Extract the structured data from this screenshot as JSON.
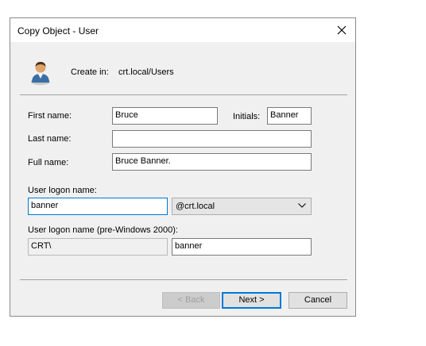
{
  "window": {
    "title": "Copy Object - User"
  },
  "header": {
    "create_in_label": "Create in:",
    "create_in_value": "crt.local/Users",
    "icon": "user-icon"
  },
  "form": {
    "first_name_label": "First name:",
    "first_name_value": "Bruce",
    "initials_label": "Initials:",
    "initials_value": "Banner",
    "last_name_label": "Last name:",
    "last_name_value": "",
    "full_name_label": "Full name:",
    "full_name_value": "Bruce Banner.",
    "logon_label": "User logon name:",
    "logon_value": "banner",
    "domain_selected": "@crt.local",
    "pre2000_label": "User logon name (pre-Windows 2000):",
    "pre2000_domain": "CRT\\",
    "pre2000_value": "banner"
  },
  "buttons": {
    "back": "< Back",
    "next": "Next >",
    "cancel": "Cancel"
  }
}
